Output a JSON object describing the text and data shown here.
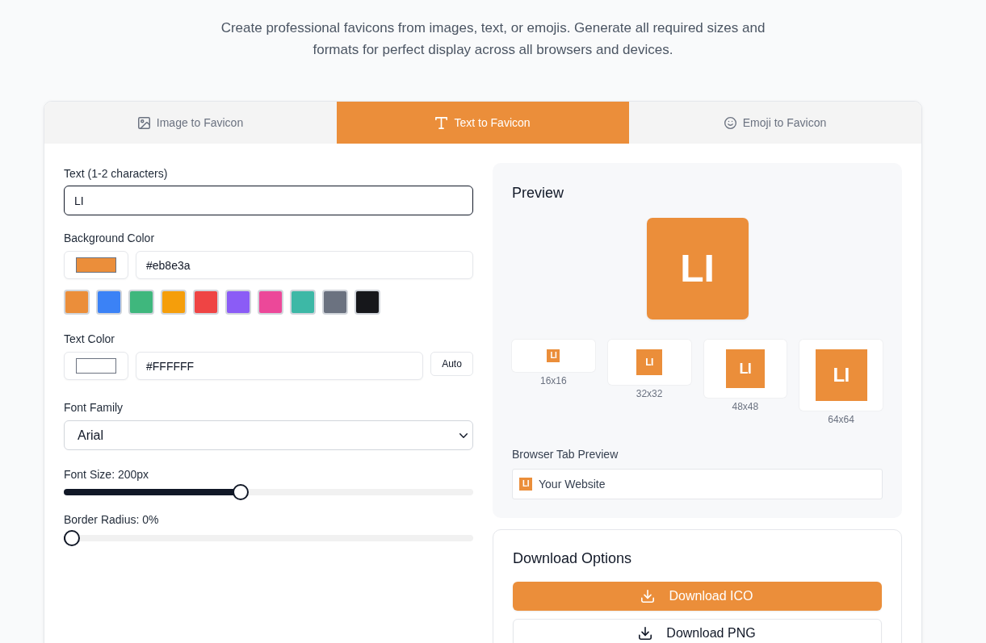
{
  "intro": "Create professional favicons from images, text, or emojis. Generate all required sizes and formats for perfect display across all browsers and devices.",
  "tabs": [
    {
      "label": "Image to Favicon",
      "kind": "image",
      "selected": false
    },
    {
      "label": "Text to Favicon",
      "kind": "text",
      "selected": true
    },
    {
      "label": "Emoji to Favicon",
      "kind": "emoji",
      "selected": false
    }
  ],
  "form": {
    "text": {
      "label": "Text (1-2 characters)",
      "value": "LI"
    },
    "background_color": {
      "label": "Background Color",
      "color": "#eb8e3a",
      "value": "#eb8e3a",
      "presets": [
        {
          "color": "#eb8e3a"
        },
        {
          "color": "#3b82f6"
        },
        {
          "color": "#3fb77d"
        },
        {
          "color": "#f59e0b"
        },
        {
          "color": "#ef4444"
        },
        {
          "color": "#8b5cf6"
        },
        {
          "color": "#ec4899"
        },
        {
          "color": "#3db8a6"
        },
        {
          "color": "#6b7280"
        },
        {
          "color": "#16171b"
        }
      ]
    },
    "text_color": {
      "label": "Text Color",
      "color": "#ffffff",
      "value": "#FFFFFF",
      "button": "Auto"
    },
    "font_family": {
      "label": "Font Family",
      "value": "Arial"
    },
    "font_size": {
      "label": "Font Size: 200px",
      "level": 0.43
    },
    "border_radius": {
      "label": "Border Radius: 0%",
      "level": 0
    }
  },
  "preview": {
    "title": "Preview",
    "text": "LI",
    "sizes": [
      {
        "text": "LI",
        "label": "16x16"
      },
      {
        "text": "LI",
        "label": "32x32"
      },
      {
        "text": "LI",
        "label": "48x48"
      },
      {
        "text": "LI",
        "label": "64x64"
      }
    ],
    "tab_label": "Browser Tab Preview",
    "tab_icon_text": "LI",
    "tab_title": "Your Website"
  },
  "downloads": {
    "title": "Download Options",
    "buttons": [
      {
        "label": "Download ICO",
        "kind": "primary"
      },
      {
        "label": "Download PNG",
        "kind": "secondary"
      }
    ]
  }
}
